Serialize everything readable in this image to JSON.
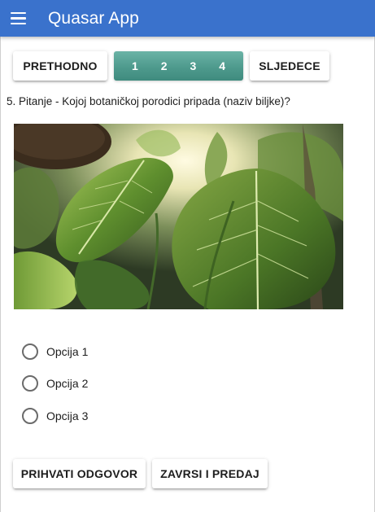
{
  "header": {
    "title": "Quasar App",
    "menu_icon": "menu-icon"
  },
  "navigation": {
    "prev_label": "PRETHODNO",
    "next_label": "SLJEDECE",
    "pages": [
      "1",
      "2",
      "3",
      "4"
    ],
    "pager_color": "#4e9a8d"
  },
  "question": {
    "text": "5. Pitanje - Kojoj botaničkoj porodici pripada (naziv biljke)?"
  },
  "image": {
    "subject": "tropical-plant-leaves-photo"
  },
  "options": [
    {
      "label": "Opcija 1"
    },
    {
      "label": "Opcija 2"
    },
    {
      "label": "Opcija 3"
    }
  ],
  "actions": {
    "accept_label": "PRIHVATI ODGOVOR",
    "finish_label": "ZAVRSI I PREDAJ"
  },
  "colors": {
    "header": "#3a72cc",
    "pager": "#4e9a8d"
  }
}
